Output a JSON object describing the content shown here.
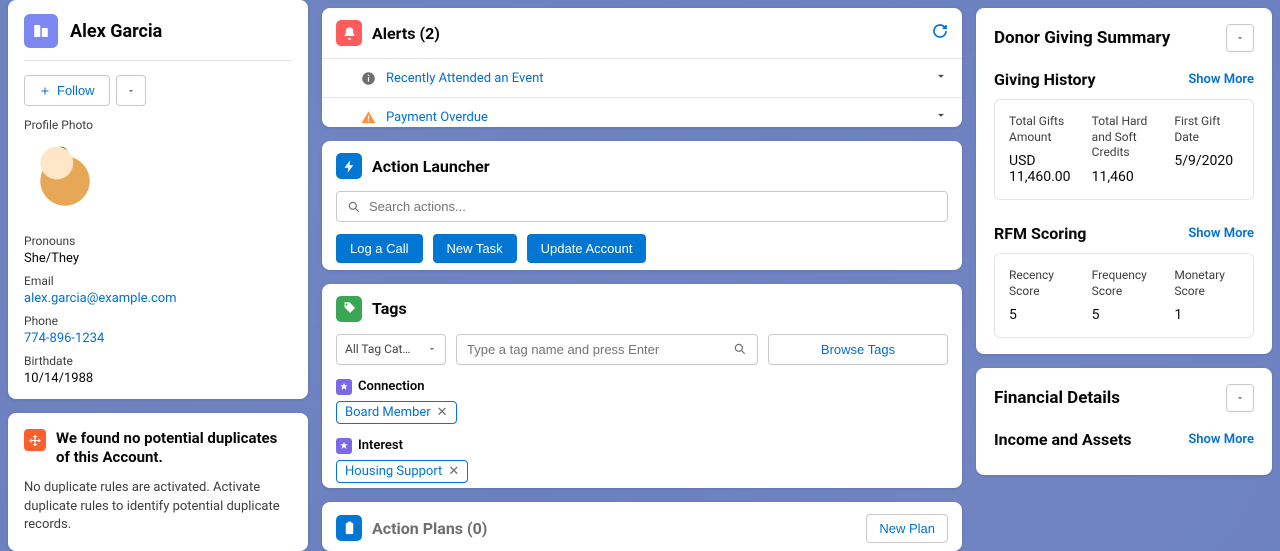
{
  "profile": {
    "name": "Alex Garcia",
    "follow_label": "Follow",
    "photo_label": "Profile Photo",
    "pronouns_label": "Pronouns",
    "pronouns": "She/They",
    "email_label": "Email",
    "email": "alex.garcia@example.com",
    "phone_label": "Phone",
    "phone": "774-896-1234",
    "birthdate_label": "Birthdate",
    "birthdate": "10/14/1988"
  },
  "duplicates": {
    "title": "We found no potential duplicates of this Account.",
    "body": "No duplicate rules are activated. Activate duplicate rules to identify potential duplicate records."
  },
  "alerts": {
    "title": "Alerts (2)",
    "items": [
      {
        "label": "Recently Attended an Event",
        "type": "info"
      },
      {
        "label": "Payment Overdue",
        "type": "warning"
      }
    ]
  },
  "action_launcher": {
    "title": "Action Launcher",
    "search_placeholder": "Search actions...",
    "buttons": [
      "Log a Call",
      "New Task",
      "Update Account"
    ]
  },
  "tags": {
    "title": "Tags",
    "filter_label": "All Tag Cat…",
    "input_placeholder": "Type a tag name and press Enter",
    "browse_label": "Browse Tags",
    "groups": [
      {
        "name": "Connection",
        "chips": [
          "Board Member"
        ]
      },
      {
        "name": "Interest",
        "chips": [
          "Housing Support"
        ]
      }
    ]
  },
  "action_plans": {
    "title": "Action Plans (0)",
    "new_label": "New Plan"
  },
  "donor_summary": {
    "title": "Donor Giving Summary",
    "giving_history": {
      "title": "Giving History",
      "show_more": "Show More",
      "metrics": [
        {
          "label": "Total Gifts Amount",
          "value": "USD 11,460.00"
        },
        {
          "label": "Total Hard and Soft Credits",
          "value": "11,460"
        },
        {
          "label": "First Gift Date",
          "value": "5/9/2020"
        }
      ]
    },
    "rfm": {
      "title": "RFM Scoring",
      "show_more": "Show More",
      "metrics": [
        {
          "label": "Recency Score",
          "value": "5"
        },
        {
          "label": "Frequency Score",
          "value": "5"
        },
        {
          "label": "Monetary Score",
          "value": "1"
        }
      ]
    }
  },
  "financial": {
    "title": "Financial Details",
    "income_title": "Income and Assets",
    "show_more": "Show More"
  }
}
